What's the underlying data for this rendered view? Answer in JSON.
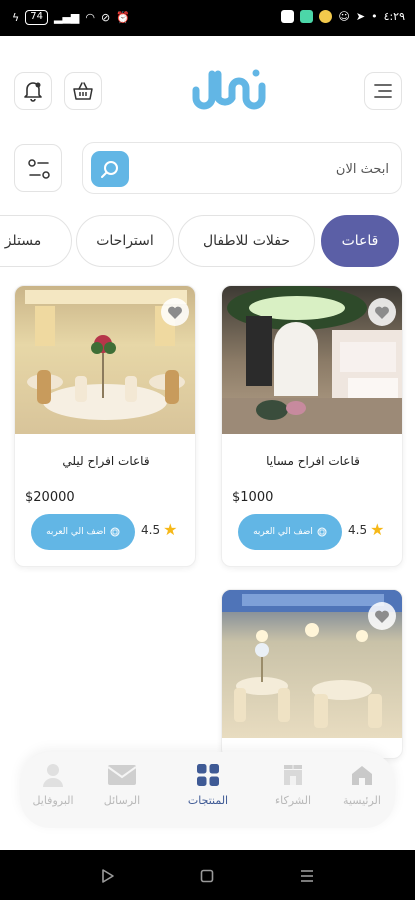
{
  "status_bar": {
    "battery": "74",
    "time": "٤:٢٩"
  },
  "header": {
    "logo_icon": "brand-logo-icon",
    "menu_icon": "menu-icon",
    "basket_icon": "basket-icon",
    "bell_icon": "bell-icon"
  },
  "search": {
    "placeholder": "ابحث الان",
    "icon": "search-icon",
    "filter_icon": "sliders-icon"
  },
  "categories": [
    {
      "label": "قاعات",
      "active": true
    },
    {
      "label": "حفلات للاطفال",
      "active": false
    },
    {
      "label": "استراحات",
      "active": false
    },
    {
      "label": "مستلز",
      "active": false
    }
  ],
  "products": [
    {
      "title": "قاعات افراح مسايا",
      "price": "$1000",
      "rating": "4.5",
      "add_label": "اضف الي العربه"
    },
    {
      "title": "قاعات افراح ليلي",
      "price": "$20000",
      "rating": "4.5",
      "add_label": "اضف الي العربه"
    },
    {
      "title": "",
      "price": "",
      "rating": "",
      "add_label": ""
    }
  ],
  "bottom_nav": [
    {
      "label": "الرئيسية",
      "icon": "home-icon",
      "active": false
    },
    {
      "label": "الشركاء",
      "icon": "store-icon",
      "active": false
    },
    {
      "label": "المنتجات",
      "icon": "grid-icon",
      "active": true
    },
    {
      "label": "الرسائل",
      "icon": "mail-icon",
      "active": false
    },
    {
      "label": "البروفايل",
      "icon": "user-icon",
      "active": false
    }
  ],
  "colors": {
    "primary": "#5b5fa6",
    "accent": "#62b6e5",
    "star": "#f6b818",
    "nav_active": "#3f5a95"
  }
}
